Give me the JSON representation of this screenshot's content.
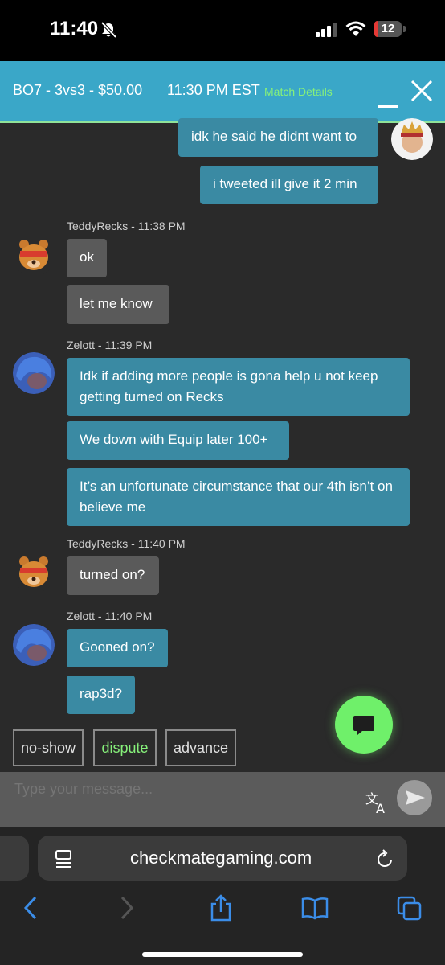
{
  "status": {
    "time": "11:40",
    "battery": "12"
  },
  "header": {
    "match": "BO7 - 3vs3 - $50.00",
    "time": "11:30 PM EST",
    "details_link": "Match Details"
  },
  "messages": {
    "m1": "idk he said he didnt want to",
    "m2": "i tweeted ill give it 2 min",
    "ted1_sender": "TeddyRecks - 11:38 PM",
    "t1": "ok",
    "t2": "let me know",
    "zel1_sender": "Zelott - 11:39 PM",
    "z1": "Idk if adding more people is gona help u not keep getting turned on Recks",
    "z2": "We down with Equip later 100+",
    "z3": "It’s an unfortunate circumstance that our 4th isn’t on believe me",
    "ted2_sender": "TeddyRecks - 11:40 PM",
    "t3": "turned on?",
    "zel2_sender": "Zelott - 11:40 PM",
    "z4": "Gooned on?",
    "z5": "rap3d?"
  },
  "actions": {
    "no_show": "no-show",
    "dispute": "dispute",
    "advance": "advance"
  },
  "composer": {
    "placeholder": "Type your message..."
  },
  "browser": {
    "url": "checkmategaming.com"
  },
  "colors": {
    "accent": "#3aa7c8",
    "green": "#6ff06a",
    "bubble": "#3a8aa3"
  },
  "icons": [
    "bell-off-icon",
    "signal-icon",
    "wifi-icon",
    "minimize-icon",
    "close-icon",
    "chat-icon",
    "translate-icon",
    "send-icon",
    "reader-icon",
    "reload-icon",
    "back-icon",
    "forward-icon",
    "share-icon",
    "bookmarks-icon",
    "tabs-icon"
  ]
}
